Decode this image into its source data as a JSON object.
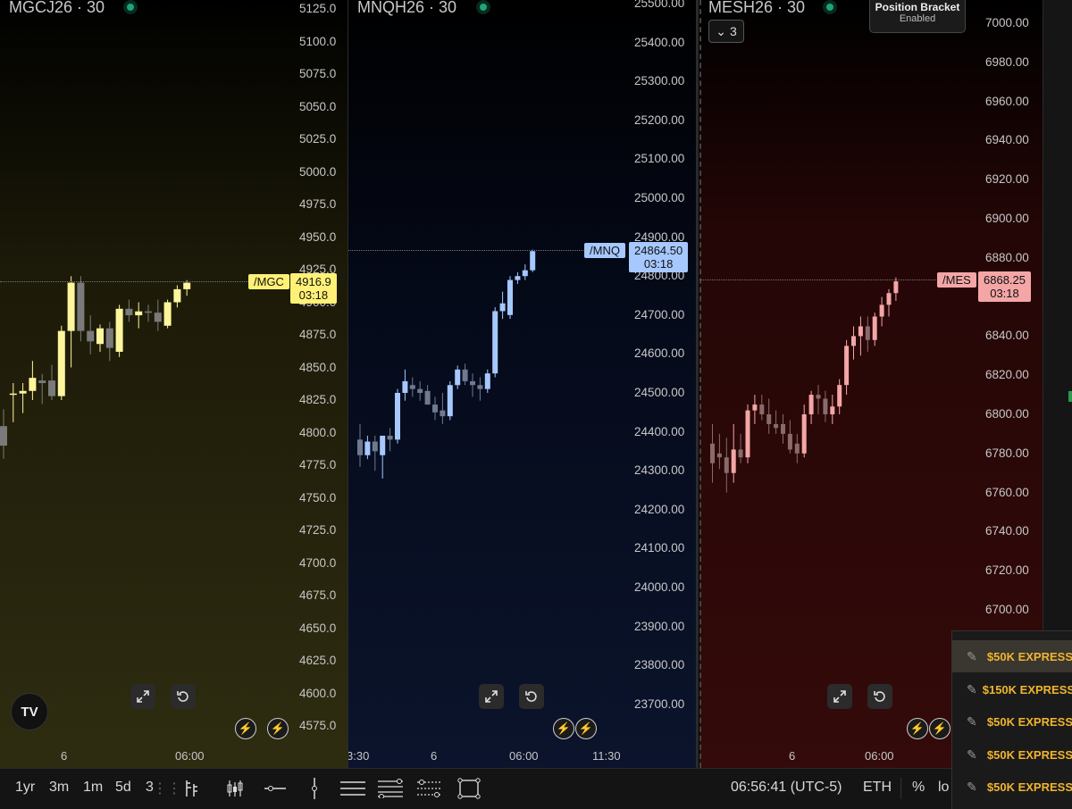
{
  "charts": [
    {
      "title": "MGCJ26 · 30",
      "y_labels": [
        "5125.0",
        "5100.0",
        "5075.0",
        "5050.0",
        "5025.0",
        "5000.0",
        "4975.0",
        "4950.0",
        "4925.0",
        "4900.0",
        "4875.0",
        "4850.0",
        "4825.0",
        "4800.0",
        "4775.0",
        "4750.0",
        "4725.0",
        "4700.0",
        "4675.0",
        "4650.0",
        "4625.0",
        "4600.0",
        "4575.0"
      ],
      "symbol_tag": "/MGC",
      "last_price": "4916.9",
      "countdown": "03:18",
      "accent": "#fff176",
      "candle_up": "#fff59d",
      "candle_down": "#7a7a7a",
      "time_labels": [
        "6",
        "06:00"
      ],
      "ohlc": [
        [
          4805,
          4818,
          4780,
          4790
        ],
        [
          4830,
          4838,
          4808,
          4830
        ],
        [
          4830,
          4838,
          4815,
          4832
        ],
        [
          4832,
          4855,
          4825,
          4842
        ],
        [
          4840,
          4845,
          4822,
          4838
        ],
        [
          4840,
          4852,
          4825,
          4828
        ],
        [
          4828,
          4882,
          4825,
          4878
        ],
        [
          4878,
          4920,
          4850,
          4915
        ],
        [
          4915,
          4920,
          4870,
          4878
        ],
        [
          4878,
          4890,
          4860,
          4870
        ],
        [
          4868,
          4883,
          4862,
          4880
        ],
        [
          4880,
          4885,
          4855,
          4865
        ],
        [
          4862,
          4898,
          4858,
          4895
        ],
        [
          4895,
          4902,
          4885,
          4890
        ],
        [
          4890,
          4900,
          4880,
          4893
        ],
        [
          4893,
          4898,
          4885,
          4892
        ],
        [
          4892,
          4902,
          4878,
          4885
        ],
        [
          4882,
          4902,
          4880,
          4900
        ],
        [
          4900,
          4913,
          4896,
          4910
        ],
        [
          4910,
          4917,
          4905,
          4915
        ]
      ]
    },
    {
      "title": "MNQH26 · 30",
      "y_labels": [
        "25500.00",
        "25400.00",
        "25300.00",
        "25200.00",
        "25100.00",
        "25000.00",
        "24900.00",
        "24800.00",
        "24700.00",
        "24600.00",
        "24500.00",
        "24400.00",
        "24300.00",
        "24200.00",
        "24100.00",
        "24000.00",
        "23900.00",
        "23800.00",
        "23700.00"
      ],
      "symbol_tag": "/MNQ",
      "last_price": "24864.50",
      "countdown": "03:18",
      "accent": "#a6c8ff",
      "candle_up": "#a6c8ff",
      "candle_down": "#6e7a8f",
      "time_labels": [
        "3:30",
        "6",
        "06:00",
        "11:30"
      ],
      "ohlc": [
        [
          24380,
          24420,
          24310,
          24340
        ],
        [
          24340,
          24390,
          24330,
          24375
        ],
        [
          24375,
          24390,
          24300,
          24350
        ],
        [
          24340,
          24360,
          24280,
          24390
        ],
        [
          24390,
          24410,
          24350,
          24380
        ],
        [
          24380,
          24510,
          24370,
          24500
        ],
        [
          24500,
          24560,
          24480,
          24530
        ],
        [
          24520,
          24540,
          24490,
          24510
        ],
        [
          24510,
          24530,
          24480,
          24500
        ],
        [
          24505,
          24520,
          24470,
          24470
        ],
        [
          24470,
          24490,
          24430,
          24450
        ],
        [
          24455,
          24500,
          24420,
          24440
        ],
        [
          24440,
          24530,
          24430,
          24520
        ],
        [
          24520,
          24570,
          24510,
          24560
        ],
        [
          24560,
          24575,
          24520,
          24530
        ],
        [
          24530,
          24550,
          24490,
          24520
        ],
        [
          24520,
          24540,
          24480,
          24510
        ],
        [
          24510,
          24560,
          24500,
          24550
        ],
        [
          24550,
          24720,
          24540,
          24710
        ],
        [
          24710,
          24760,
          24690,
          24730
        ],
        [
          24700,
          24800,
          24690,
          24790
        ],
        [
          24790,
          24810,
          24780,
          24800
        ],
        [
          24800,
          24830,
          24790,
          24815
        ],
        [
          24815,
          24868,
          24810,
          24864
        ]
      ]
    },
    {
      "title": "MESH26 · 30",
      "y_labels": [
        "7000.00",
        "6980.00",
        "6960.00",
        "6940.00",
        "6920.00",
        "6900.00",
        "6880.00",
        "6860.00",
        "6840.00",
        "6820.00",
        "6800.00",
        "6780.00",
        "6760.00",
        "6740.00",
        "6720.00",
        "6700.00"
      ],
      "symbol_tag": "/MES",
      "last_price": "6868.25",
      "countdown": "03:18",
      "accent": "#f4a6a6",
      "candle_up": "#f4a6a6",
      "candle_down": "#8a6a6a",
      "time_labels": [
        "6",
        "06:00"
      ],
      "ohlc": [
        [
          6785,
          6795,
          6765,
          6775
        ],
        [
          6780,
          6790,
          6772,
          6778
        ],
        [
          6778,
          6788,
          6760,
          6770
        ],
        [
          6770,
          6795,
          6765,
          6782
        ],
        [
          6782,
          6790,
          6775,
          6778
        ],
        [
          6778,
          6805,
          6775,
          6802
        ],
        [
          6802,
          6810,
          6795,
          6805
        ],
        [
          6805,
          6810,
          6797,
          6800
        ],
        [
          6800,
          6808,
          6790,
          6795
        ],
        [
          6795,
          6802,
          6790,
          6793
        ],
        [
          6795,
          6800,
          6785,
          6790
        ],
        [
          6790,
          6797,
          6780,
          6782
        ],
        [
          6785,
          6790,
          6775,
          6780
        ],
        [
          6780,
          6805,
          6778,
          6800
        ],
        [
          6800,
          6812,
          6795,
          6810
        ],
        [
          6810,
          6815,
          6800,
          6808
        ],
        [
          6808,
          6812,
          6796,
          6800
        ],
        [
          6800,
          6810,
          6795,
          6804
        ],
        [
          6804,
          6818,
          6800,
          6815
        ],
        [
          6815,
          6838,
          6810,
          6835
        ],
        [
          6835,
          6845,
          6828,
          6840
        ],
        [
          6840,
          6850,
          6830,
          6845
        ],
        [
          6845,
          6850,
          6832,
          6838
        ],
        [
          6838,
          6852,
          6835,
          6850
        ],
        [
          6850,
          6860,
          6845,
          6856
        ],
        [
          6856,
          6864,
          6850,
          6862
        ],
        [
          6862,
          6870,
          6858,
          6868
        ]
      ]
    }
  ],
  "controls": {
    "expand_icon": "expand-icon",
    "reset_icon": "reset-icon",
    "bolt_icon": "⚡"
  },
  "overlay": {
    "bracket_title": "Position Bracket",
    "bracket_status": "Enabled",
    "layout_count": "3"
  },
  "toolbar": {
    "timeframes": [
      "1yr",
      "3m",
      "1m",
      "5d",
      "3"
    ],
    "clock": "06:56:41 (UTC-5)",
    "session": "ETH",
    "percent": "%",
    "log": "lo"
  },
  "accounts": [
    {
      "name": "$50K EXPRESS",
      "selected": true
    },
    {
      "name": "$150K EXPRESS",
      "selected": false
    },
    {
      "name": "$50K EXPRESS",
      "selected": false
    },
    {
      "name": "$50K EXPRESS",
      "selected": false
    },
    {
      "name": "$50K EXPRESS",
      "selected": false
    }
  ]
}
